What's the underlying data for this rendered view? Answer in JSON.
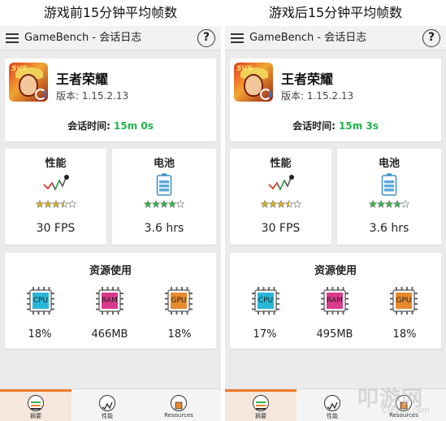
{
  "colors": {
    "accent_green": "#22b14c",
    "accent_orange": "#f07c2a",
    "star_green": "#32b54a",
    "star_yellow": "#d9b21a",
    "cpu_cyan": "#29b6d8",
    "ram_magenta": "#d93a8c",
    "gpu_orange": "#e8892b"
  },
  "panels": [
    {
      "caption": "游戏前15分钟平均帧数",
      "appbar": {
        "title": "GameBench - 会话日志",
        "help": "?"
      },
      "game": {
        "name": "王者荣耀",
        "version": "版本: 1.15.2.13",
        "session_label": "会话时间: ",
        "session_time": "15m 0s",
        "icon_badge": "5V5"
      },
      "performance": {
        "label": "性能",
        "icon": "performance-chart-icon",
        "stars": 3.5,
        "value": "30 FPS"
      },
      "battery": {
        "label": "电池",
        "icon": "battery-icon",
        "stars": 4,
        "value": "3.6 hrs"
      },
      "resources": {
        "label": "资源使用",
        "items": [
          {
            "name": "CPU",
            "icon": "cpu-chip-icon",
            "value": "18%"
          },
          {
            "name": "RAM",
            "icon": "ram-chip-icon",
            "value": "466MB"
          },
          {
            "name": "GPU",
            "icon": "gpu-chip-icon",
            "value": "18%"
          }
        ]
      },
      "nav": [
        {
          "label": "摘要",
          "icon": "summary-icon"
        },
        {
          "label": "性能",
          "icon": "performance-icon"
        },
        {
          "label": "Resources",
          "icon": "resources-icon"
        }
      ]
    },
    {
      "caption": "游戏后15分钟平均帧数",
      "appbar": {
        "title": "GameBench - 会话日志",
        "help": "?"
      },
      "game": {
        "name": "王者荣耀",
        "version": "版本: 1.15.2.13",
        "session_label": "会话时间: ",
        "session_time": "15m 3s",
        "icon_badge": "5V5"
      },
      "performance": {
        "label": "性能",
        "icon": "performance-chart-icon",
        "stars": 3.5,
        "value": "30 FPS"
      },
      "battery": {
        "label": "电池",
        "icon": "battery-icon",
        "stars": 4,
        "value": "3.6 hrs"
      },
      "resources": {
        "label": "资源使用",
        "items": [
          {
            "name": "CPU",
            "icon": "cpu-chip-icon",
            "value": "17%"
          },
          {
            "name": "RAM",
            "icon": "ram-chip-icon",
            "value": "495MB"
          },
          {
            "name": "GPU",
            "icon": "gpu-chip-icon",
            "value": "18%"
          }
        ]
      },
      "nav": [
        {
          "label": "摘要",
          "icon": "summary-icon"
        },
        {
          "label": "性能",
          "icon": "performance-icon"
        },
        {
          "label": "Resources",
          "icon": "resources-icon"
        }
      ]
    }
  ],
  "watermark": {
    "text": "叩游网",
    "sub": "Cleyou.com"
  }
}
